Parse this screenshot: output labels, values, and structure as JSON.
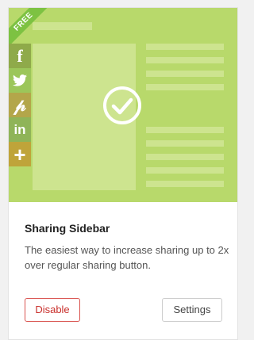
{
  "card": {
    "ribbon": "FREE",
    "title": "Sharing Sidebar",
    "description": "The easiest way to increase sharing up to 2x over regular sharing button.",
    "disable_label": "Disable",
    "settings_label": "Settings",
    "status_icon": "checkmark-circle-icon",
    "share_icons": [
      "facebook-icon",
      "twitter-icon",
      "pinterest-icon",
      "linkedin-icon",
      "plus-icon"
    ]
  },
  "colors": {
    "preview_bg": "#b8d96b",
    "ribbon_bg": "#7dc242",
    "disable_border": "#d9534f"
  }
}
